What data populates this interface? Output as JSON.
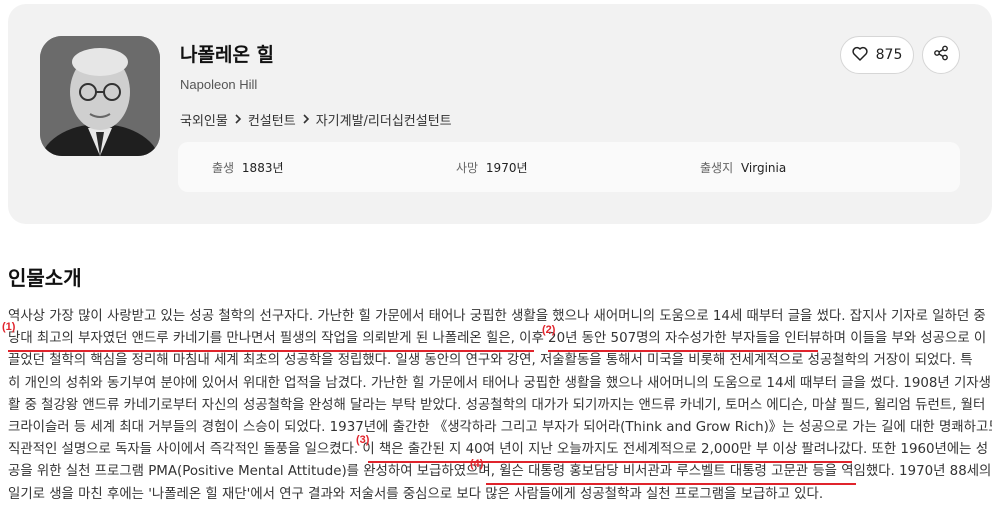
{
  "person": {
    "name_ko": "나폴레온 힐",
    "name_en": "Napoleon Hill",
    "breadcrumb": [
      "국외인물",
      "컨설턴트",
      "자기계발/리더십컨설턴트"
    ],
    "likes": "875",
    "info": {
      "birth_label": "출생",
      "birth_value": "1883년",
      "death_label": "사망",
      "death_value": "1970년",
      "place_label": "출생지",
      "place_value": "Virginia"
    }
  },
  "section": {
    "title": "인물소개"
  },
  "intro_lines": [
    "역사상 가장 많이 사랑받고 있는 성공 철학의 선구자다. 가난한 힐 가문에서 태어나 궁핍한 생활을 했으나 새어머니의 도움으로 14세 때부터 글을 썼다. 잡지사 기자로 일하던 중",
    "당대 최고의 부자였던 앤드루 카네기를 만나면서 필생의 작업을 의뢰받게 된 나폴레온 힐은, 이후 20년 동안 507명의 자수성가한 부자들을 인터뷰하며 이들을 부와 성공으로 이",
    "끌었던 철학의 핵심을 정리해 마침내 세계 최초의 성공학을 정립했다. 일생 동안의 연구와 강연, 저술활동을 통해서 미국을 비롯해 전세계적으로 성공철학의 거장이 되었다. 특",
    "히 개인의 성취와 동기부여 분야에 있어서 위대한 업적을 남겼다. 가난한 힐 가문에서 태어나 궁핍한 생활을 했으나 새어머니의 도움으로 14세 때부터 글을 썼다. 1908년 기자생",
    "활 중 철강왕 앤드류 카네기로부터 자신의 성공철학을 완성해 달라는 부탁 받았다. 성공철학의 대가가 되기까지는 앤드류 카네기, 토머스 에디슨, 마샬 필드, 윌리엄 듀런트, 월터",
    "크라이슬러 등 세계 최대 거부들의 경험이 스승이 되었다. 1937년에 출간한 《생각하라 그리고 부자가 되어라(Think and Grow Rich)》는 성공으로 가는 길에 대한 명쾌하고도",
    "직관적인 설명으로 독자들 사이에서 즉각적인 돌풍을 일으켰다. 이 책은 출간된 지 40여 년이 지난 오늘까지도 전세계적으로 2,000만 부 이상 팔려나갔다. 또한 1960년에는 성",
    "공을 위한 실천 프로그램 PMA(Positive Mental Attitude)를 완성하여 보급하였으며, 윌슨 대통령 홍보담당 비서관과 루스벨트 대통령 고문관 등을 역임했다. 1970년 88세의",
    "일기로 생을 마친 후에는 '나폴레온 힐 재단'에서 연구 결과와 저술서를 중심으로 보다 많은 사람들에게 성공철학과 실천 프로그램을 보급하고 있다."
  ],
  "annotations": [
    "(1)",
    "(2)",
    "(3)",
    "(4)"
  ],
  "colors": {
    "annotation": "#e0242c",
    "card_bg": "#f2f2f2"
  },
  "icons": [
    "heart-icon",
    "share-icon",
    "chevron-right-icon"
  ]
}
